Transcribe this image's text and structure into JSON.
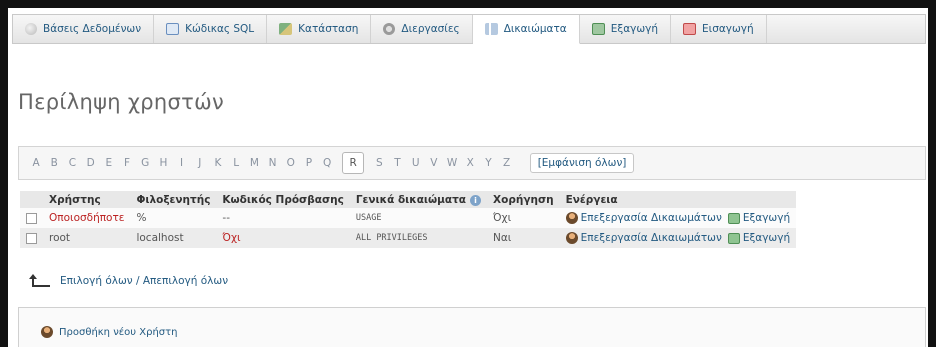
{
  "tabs": [
    {
      "label": "Βάσεις Δεδομένων",
      "icon": "database-icon"
    },
    {
      "label": "Κώδικας SQL",
      "icon": "sql-icon"
    },
    {
      "label": "Κατάσταση",
      "icon": "status-icon"
    },
    {
      "label": "Διεργασίες",
      "icon": "processes-icon"
    },
    {
      "label": "Δικαιώματα",
      "icon": "privileges-icon",
      "active": true
    },
    {
      "label": "Εξαγωγή",
      "icon": "export-icon"
    },
    {
      "label": "Εισαγωγή",
      "icon": "import-icon"
    }
  ],
  "page_title": "Περίληψη χρηστών",
  "alphabet": [
    "A",
    "B",
    "C",
    "D",
    "E",
    "F",
    "G",
    "H",
    "I",
    "J",
    "K",
    "L",
    "M",
    "N",
    "O",
    "P",
    "Q",
    "R",
    "S",
    "T",
    "U",
    "V",
    "W",
    "X",
    "Y",
    "Z"
  ],
  "selected_letter": "R",
  "show_all": "[Εμφάνιση όλων]",
  "table": {
    "headers": [
      "Χρήστης",
      "Φιλοξενητής",
      "Κωδικός Πρόσβασης",
      "Γενικά δικαιώματα",
      "Χορήγηση",
      "Ενέργεια"
    ],
    "rows": [
      {
        "user": "Οποιοσδήποτε",
        "host": "%",
        "password": "--",
        "privileges": "USAGE",
        "grant": "Όχι",
        "edit": "Επεξεργασία Δικαιωμάτων",
        "export": "Εξαγωγή"
      },
      {
        "user": "root",
        "host": "localhost",
        "password": "Όχι",
        "privileges": "ALL PRIVILEGES",
        "grant": "Ναι",
        "edit": "Επεξεργασία Δικαιωμάτων",
        "export": "Εξαγωγή"
      }
    ]
  },
  "select_all": "Επιλογή όλων / Απεπιλογή όλων",
  "add_user": "Προσθήκη νέου Χρήστη",
  "colors": {
    "link": "#235a81",
    "warning": "#bb2222"
  }
}
